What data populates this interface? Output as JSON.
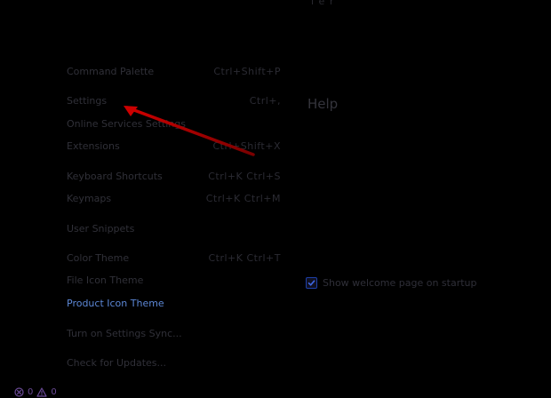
{
  "top_fragment": "l e r",
  "menu": {
    "items": [
      {
        "label": "Command Palette",
        "shortcut": "Ctrl+Shift+P"
      },
      {
        "label": "Settings",
        "shortcut": "Ctrl+,"
      },
      {
        "label": "Online Services Settings",
        "shortcut": ""
      },
      {
        "label": "Extensions",
        "shortcut": "Ctrl+Shift+X"
      },
      {
        "label": "Keyboard Shortcuts",
        "shortcut": "Ctrl+K Ctrl+S"
      },
      {
        "label": "Keymaps",
        "shortcut": "Ctrl+K Ctrl+M"
      },
      {
        "label": "User Snippets",
        "shortcut": ""
      },
      {
        "label": "Color Theme",
        "shortcut": "Ctrl+K Ctrl+T"
      },
      {
        "label": "File Icon Theme",
        "shortcut": ""
      },
      {
        "label": "Product Icon Theme",
        "shortcut": ""
      },
      {
        "label": "Turn on Settings Sync...",
        "shortcut": ""
      },
      {
        "label": "Check for Updates...",
        "shortcut": ""
      }
    ]
  },
  "help_fragment": "Help",
  "startup": {
    "checked": true,
    "label": "Show welcome page on startup"
  },
  "status": {
    "errors": "0",
    "warnings": "0"
  },
  "colors": {
    "highlight": "#5c87d6",
    "arrow": "#c00000",
    "checkbox_accent": "#1d3fa8"
  },
  "icons": {
    "error": "error-circle-icon",
    "warning": "warning-triangle-icon",
    "check": "check-icon"
  }
}
